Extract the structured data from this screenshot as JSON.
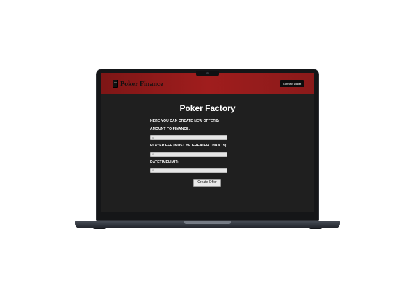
{
  "header": {
    "logo_text": "Poker Finance",
    "connect_button": "Connect wallet"
  },
  "main": {
    "title": "Poker Factory",
    "intro": "HERE YOU CAN CREATE NEW OFFERS:",
    "fields": [
      {
        "label": "AMOUNT TO FINANCE:",
        "placeholder": "0"
      },
      {
        "label": "PLAYER FEE (MUST BE GREATER THAN 15):",
        "placeholder": "0"
      },
      {
        "label": "DATETIMELIMIT:",
        "placeholder": "0"
      }
    ],
    "submit_button": "Create Offer"
  },
  "colors": {
    "header_red": "#a01d1d",
    "screen_bg": "#1f1f1f",
    "text": "#ffffff"
  }
}
